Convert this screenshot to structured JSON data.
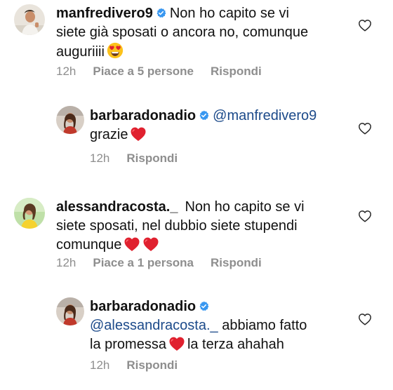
{
  "comments": [
    {
      "username": "manfredivero9",
      "verified": true,
      "text_line1": "Non ho capito se vi",
      "text_line2": "siete già sposati o ancora no, comunque",
      "text_line3": "auguriiii",
      "emoji": "smiling-face-with-heart-eyes",
      "time": "12h",
      "likes": "Piace a 5 persone",
      "reply": "Rispondi"
    },
    {
      "username": "barbaradonadio",
      "verified": true,
      "mention": "@manfredivero9",
      "text_line2": "grazie",
      "emoji": "red-heart",
      "time": "12h",
      "reply": "Rispondi"
    },
    {
      "username": "alessandracosta._",
      "text_line1": "Non ho capito se vi",
      "text_line2": "siete sposati, nel dubbio siete stupendi",
      "text_line3": "comunque",
      "emoji": "red-heart x2",
      "time": "12h",
      "likes": "Piace a 1 persona",
      "reply": "Rispondi"
    },
    {
      "username": "barbaradonadio",
      "verified": true,
      "mention": "@alessandracosta._",
      "text_after_mention": "abbiamo fatto",
      "text_line3a": "la promessa",
      "text_line3b": "la terza ahahah",
      "emoji": "red-heart",
      "time": "12h",
      "reply": "Rispondi"
    }
  ],
  "colors": {
    "text": "#111111",
    "secondary": "#8e8e8e",
    "mention": "#1c4a8a",
    "verified": "#3897f0",
    "heart": "#e0212f"
  }
}
